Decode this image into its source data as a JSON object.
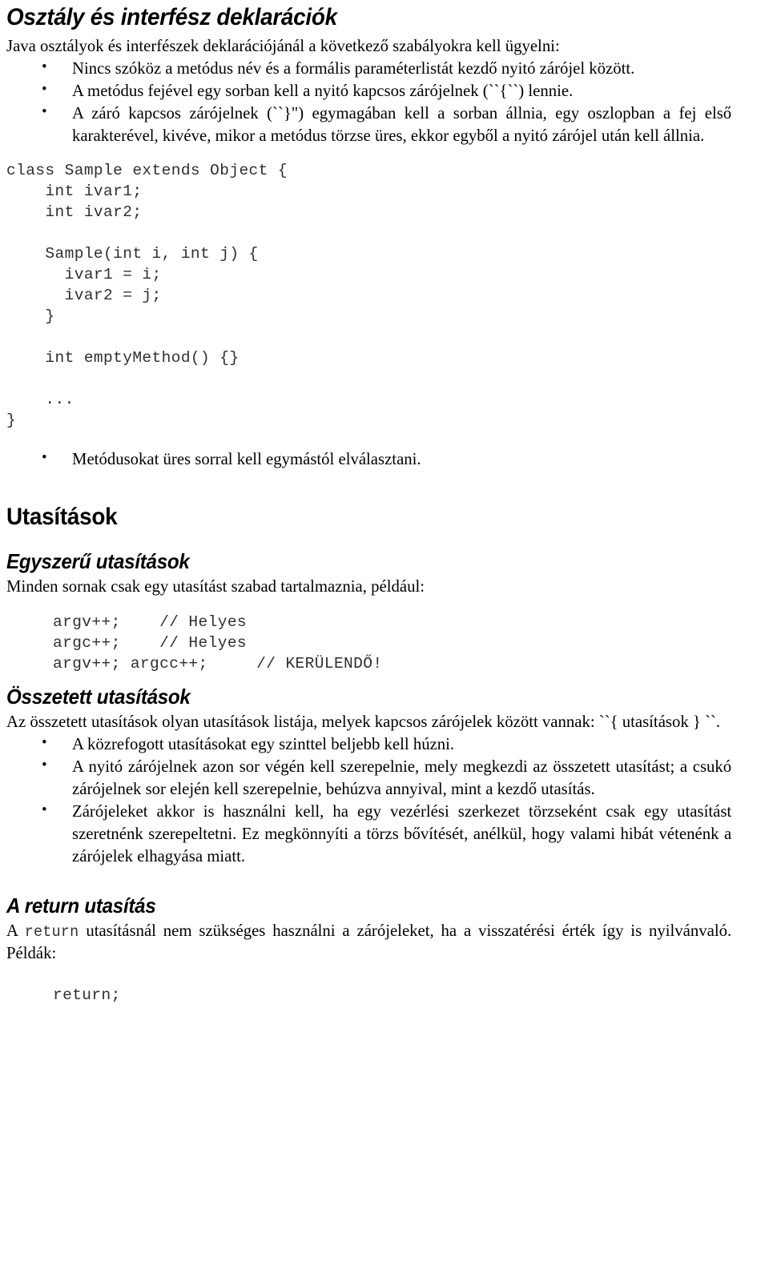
{
  "document": {
    "title": "Osztály és interfész deklarációk",
    "intro": "Java osztályok és interfészek deklarációjánál a következő szabályokra kell ügyelni:",
    "declaration_rules": [
      "Nincs szóköz a metódus név és a formális paraméterlistát kezdő nyitó zárójel között.",
      "A metódus fejével egy sorban kell a nyitó kapcsos zárójelnek (``{``) lennie.",
      "A záró kapcsos zárójelnek (``}\") egymagában kell a sorban állnia, egy oszlopban a fej első karakterével, kivéve, mikor a metódus törzse üres, ekkor egyből a nyitó zárójel után kell állnia."
    ],
    "sample_class_code": "class Sample extends Object {\n    int ivar1;\n    int ivar2;\n\n    Sample(int i, int j) {\n      ivar1 = i;\n      ivar2 = j;\n    }\n\n    int emptyMethod() {}\n\n    ...\n}",
    "method_separation_rule": "Metódusokat üres sorral kell egymástól elválasztani.",
    "statements_heading": "Utasítások",
    "simple_statements_heading": "Egyszerű utasítások",
    "simple_statements_text": "Minden sornak csak egy utasítást szabad tartalmaznia, például:",
    "simple_statements_code": "argv++;    // Helyes\nargc++;    // Helyes\nargv++; argcc++;     // KERÜLENDŐ!",
    "compound_statements_heading": "Összetett utasítások",
    "compound_statements_text": "Az összetett utasítások olyan utasítások listája, melyek kapcsos zárójelek között vannak: ``{ utasítások } ``.",
    "compound_rules": [
      "A közrefogott utasításokat egy szinttel beljebb kell húzni.",
      "A nyitó zárójelnek azon sor végén kell szerepelnie, mely megkezdi az összetett utasítást; a csukó zárójelnek sor elején kell szerepelnie, behúzva annyival, mint a kezdő utasítás.",
      "Zárójeleket akkor is használni kell, ha egy vezérlési szerkezet törzseként csak egy utasítást szeretnénk szerepeltetni. Ez megkönnyíti a törzs bővítését, anélkül, hogy valami hibát vétenénk a zárójelek elhagyása miatt."
    ],
    "return_heading": "A return utasítás",
    "return_text_before": "A ",
    "return_text_code": "return",
    "return_text_after": " utasításnál nem szükséges használni a zárójeleket, ha a visszatérési érték így is nyilvánvaló. Példák:",
    "return_code": "return;",
    "bullet_glyph": "•"
  }
}
